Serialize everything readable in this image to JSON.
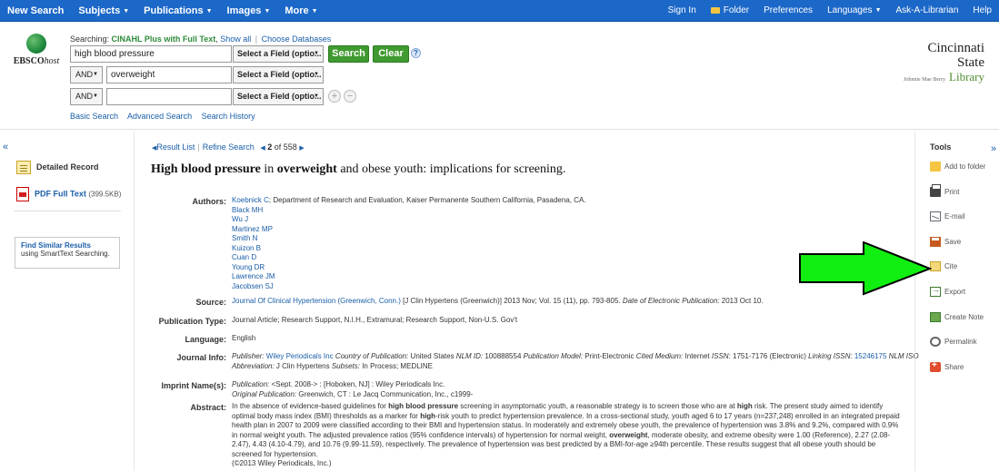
{
  "topnav": {
    "left": [
      {
        "label": "New Search",
        "caret": false
      },
      {
        "label": "Subjects",
        "caret": true
      },
      {
        "label": "Publications",
        "caret": true
      },
      {
        "label": "Images",
        "caret": true
      },
      {
        "label": "More",
        "caret": true
      }
    ],
    "right": [
      {
        "label": "Sign In",
        "caret": false,
        "folder": false
      },
      {
        "label": "Folder",
        "caret": false,
        "folder": true
      },
      {
        "label": "Preferences",
        "caret": false,
        "folder": false
      },
      {
        "label": "Languages",
        "caret": true,
        "folder": false
      },
      {
        "label": "Ask-A-Librarian",
        "caret": false,
        "folder": false
      },
      {
        "label": "Help",
        "caret": false,
        "folder": false
      }
    ]
  },
  "search": {
    "searching_prefix": "Searching:",
    "database": "CINAHL Plus with Full Text",
    "show_all": "Show all",
    "choose_databases": "Choose Databases",
    "rows": [
      {
        "bool": "",
        "term": "high blood pressure",
        "field": "Select a Field (optio..."
      },
      {
        "bool": "AND",
        "term": "overweight",
        "field": "Select a Field (optio..."
      },
      {
        "bool": "AND",
        "term": "",
        "field": "Select a Field (optio..."
      }
    ],
    "search_button": "Search",
    "clear_button": "Clear",
    "help": "?",
    "plus": "+",
    "minus": "−",
    "links": [
      "Basic Search",
      "Advanced Search",
      "Search History"
    ]
  },
  "logos": {
    "ebsco": "EBSCO",
    "ebsco_host": "host",
    "cinc_line1": "Cincinnati State",
    "cinc_line2": "Johnnie Mae Berry",
    "cinc_line3": "Library"
  },
  "left": {
    "collapse": "«",
    "detailed_record": "Detailed Record",
    "pdf_label": "PDF Full Text",
    "pdf_size": "(399.5KB)",
    "similar_title": "Find Similar Results",
    "similar_sub": "using SmartText Searching."
  },
  "resultnav": {
    "result_list": "Result List",
    "refine_search": "Refine Search",
    "position": "2",
    "of_total": "of 558"
  },
  "record": {
    "title_parts": [
      {
        "text": "High blood pressure",
        "bold": true
      },
      {
        "text": " in ",
        "bold": false
      },
      {
        "text": "overweight",
        "bold": true
      },
      {
        "text": " and obese youth: implications for screening.",
        "bold": false
      }
    ],
    "authors_label": "Authors:",
    "authors": [
      {
        "name": "Koebnick C",
        "affil": "; Department of Research and Evaluation, Kaiser Permanente Southern California, Pasadena, CA."
      },
      {
        "name": "Black MH",
        "affil": ""
      },
      {
        "name": "Wu J",
        "affil": ""
      },
      {
        "name": "Martinez MP",
        "affil": ""
      },
      {
        "name": "Smith N",
        "affil": ""
      },
      {
        "name": "Kuizon B",
        "affil": ""
      },
      {
        "name": "Cuan D",
        "affil": ""
      },
      {
        "name": "Young DR",
        "affil": ""
      },
      {
        "name": "Lawrence JM",
        "affil": ""
      },
      {
        "name": "Jacobsen SJ",
        "affil": ""
      }
    ],
    "source_label": "Source:",
    "source_link": "Journal Of Clinical Hypertension (Greenwich, Conn.)",
    "source_text": " [J Clin Hypertens (Greenwich)] 2013 Nov; Vol. 15 (11), pp. 793-805.",
    "source_epub": " Date of Electronic Publication: ",
    "source_epub_date": "2013 Oct 10.",
    "pubtype_label": "Publication Type:",
    "pubtype": "Journal Article; Research Support, N.I.H., Extramural; Research Support, Non-U.S. Gov't",
    "language_label": "Language:",
    "language": "English",
    "journal_label": "Journal Info:",
    "journal_publisher_lbl": "Publisher: ",
    "journal_publisher": "Wiley Periodicals Inc",
    "journal_country_lbl": " Country of Publication: ",
    "journal_country": "United States",
    "journal_nlm_lbl": " NLM ID: ",
    "journal_nlm": "100888554",
    "journal_model_lbl": " Publication Model: ",
    "journal_model": "Print-Electronic",
    "journal_medium_lbl": " Cited Medium: ",
    "journal_medium": "Internet",
    "journal_issn_lbl": " ISSN: ",
    "journal_issn": "1751-7176 (Electronic)",
    "journal_linking_lbl": " Linking ISSN: ",
    "journal_linking": "15246175",
    "journal_abbrev_lbl": " NLM ISO",
    "journal_abbrev_lbl2": "Abbreviation: ",
    "journal_abbrev": "J Clin Hypertens",
    "journal_subsets_lbl": " Subsets: ",
    "journal_subsets": "In Process; MEDLINE",
    "imprint_label": "Imprint Name(s):",
    "imprint_pub_lbl": "Publication: ",
    "imprint_pub": "<Sept. 2008-> : [Hoboken, NJ] : Wiley Periodicals Inc.",
    "imprint_orig_lbl": "Original Publication: ",
    "imprint_orig": "Greenwich, CT : Le Jacq Communication, Inc., c1999-",
    "abstract_label": "Abstract:",
    "abstract_parts": [
      {
        "text": "In the absence of evidence-based guidelines for ",
        "bold": false
      },
      {
        "text": "high blood pressure",
        "bold": true
      },
      {
        "text": " screening in asymptomatic youth, a reasonable strategy is to screen those who are at ",
        "bold": false
      },
      {
        "text": "high",
        "bold": true
      },
      {
        "text": " risk. The present study aimed to identify optimal body mass index (BMI) thresholds as a marker for ",
        "bold": false
      },
      {
        "text": "high",
        "bold": true
      },
      {
        "text": "-risk youth to predict hypertension prevalence. In a cross-sectional study, youth aged 6 to 17 years (n=237,248) enrolled in an integrated prepaid health plan in 2007 to 2009 were classified according to their BMI and hypertension status. In moderately and extremely obese youth, the prevalence of hypertension was 3.8% and 9.2%, compared with 0.9% in normal weight youth. The adjusted prevalence ratios (95% confidence intervals) of hypertension for normal weight, ",
        "bold": false
      },
      {
        "text": "overweight",
        "bold": true
      },
      {
        "text": ", moderate obesity, and extreme obesity were 1.00 (Reference), 2.27 (2.08-2.47), 4.43 (4.10-4.79), and 10.76 (9.99-11.59), respectively. The prevalence of hypertension was best predicted by a BMI-for-age ≥94th percentile. These results suggest that all obese youth should be screened for hypertension.",
        "bold": false
      }
    ],
    "abstract_copyright": "(©2013 Wiley Periodicals, Inc.)"
  },
  "tools": {
    "title": "Tools",
    "collapse": "»",
    "items": [
      {
        "label": "Add to folder",
        "icon": "folder-icon"
      },
      {
        "label": "Print",
        "icon": "printer-icon"
      },
      {
        "label": "E-mail",
        "icon": "email-icon"
      },
      {
        "label": "Save",
        "icon": "save-icon"
      },
      {
        "label": "Cite",
        "icon": "cite-icon"
      },
      {
        "label": "Export",
        "icon": "export-icon"
      },
      {
        "label": "Create Note",
        "icon": "note-icon"
      },
      {
        "label": "Permalink",
        "icon": "link-icon"
      },
      {
        "label": "Share",
        "icon": "share-icon"
      }
    ]
  },
  "colors": {
    "nav_blue": "#1c68c8",
    "link_blue": "#1a5ea8",
    "button_green": "#3f9a2f",
    "annotation_arrow": "#11ee11"
  }
}
